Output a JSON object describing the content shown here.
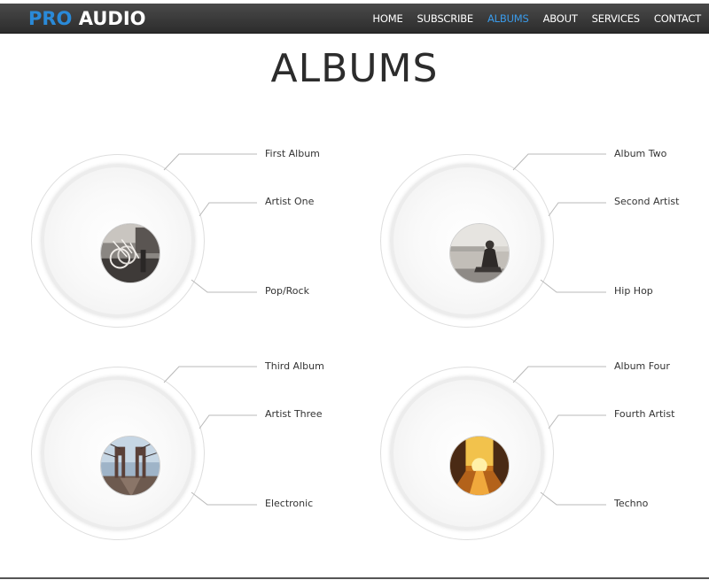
{
  "header": {
    "logo_pro": "PRO",
    "logo_audio": "AUDIO",
    "nav": [
      {
        "label": "HOME",
        "active": false
      },
      {
        "label": "SUBSCRIBE",
        "active": false
      },
      {
        "label": "ALBUMS",
        "active": true
      },
      {
        "label": "ABOUT",
        "active": false
      },
      {
        "label": "SERVICES",
        "active": false
      },
      {
        "label": "CONTACT",
        "active": false
      }
    ]
  },
  "page": {
    "title": "ALBUMS"
  },
  "albums": [
    {
      "title": "First Album",
      "artist": "Artist One",
      "genre": "Pop/Rock",
      "cover_icon": "bicycles-photo"
    },
    {
      "title": "Album Two",
      "artist": "Second Artist",
      "genre": "Hip Hop",
      "cover_icon": "person-by-water-photo"
    },
    {
      "title": "Third Album",
      "artist": "Artist Three",
      "genre": "Electronic",
      "cover_icon": "bridge-photo"
    },
    {
      "title": "Album Four",
      "artist": "Fourth Artist",
      "genre": "Techno",
      "cover_icon": "sunset-street-photo"
    }
  ],
  "colors": {
    "accent": "#3a9bea",
    "navbar": "#2c2c2c",
    "text": "#333333"
  }
}
